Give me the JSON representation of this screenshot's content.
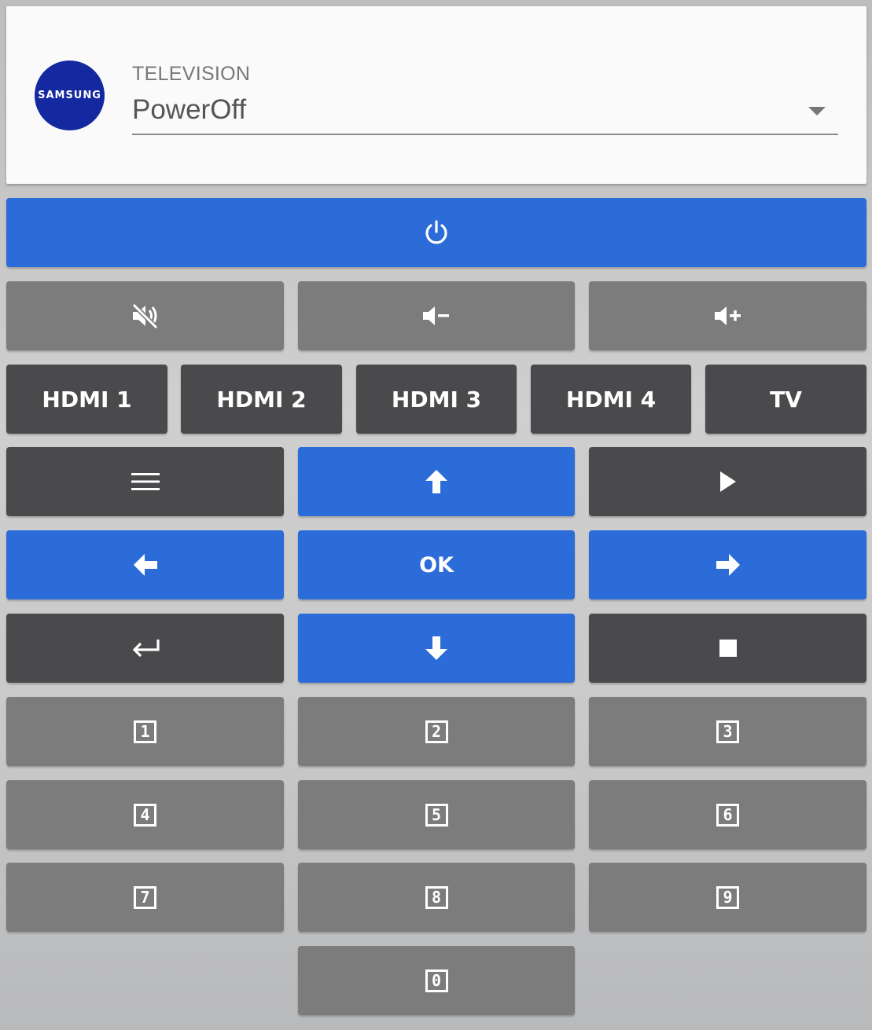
{
  "header": {
    "logo_text": "SAMSUNG",
    "select_label": "TELEVISION",
    "select_value": "PowerOff"
  },
  "remote": {
    "power_icon": "power-icon",
    "volume_row": [
      {
        "icon": "volume-mute-icon"
      },
      {
        "icon": "volume-down-icon"
      },
      {
        "icon": "volume-up-icon"
      }
    ],
    "sources": [
      "HDMI 1",
      "HDMI 2",
      "HDMI 3",
      "HDMI 4",
      "TV"
    ],
    "nav": {
      "menu_icon": "menu-icon",
      "up_icon": "arrow-up-icon",
      "play_icon": "play-icon",
      "left_icon": "arrow-left-icon",
      "ok_label": "OK",
      "right_icon": "arrow-right-icon",
      "return_icon": "return-icon",
      "down_icon": "arrow-down-icon",
      "stop_icon": "stop-icon"
    },
    "numbers": [
      "1",
      "2",
      "3",
      "4",
      "5",
      "6",
      "7",
      "8",
      "9",
      "0"
    ]
  },
  "colors": {
    "blue": "#2c6cd8",
    "dark": "#4a4a4c",
    "grey": "#7c7c7c",
    "samsung_blue": "#1428a0"
  }
}
